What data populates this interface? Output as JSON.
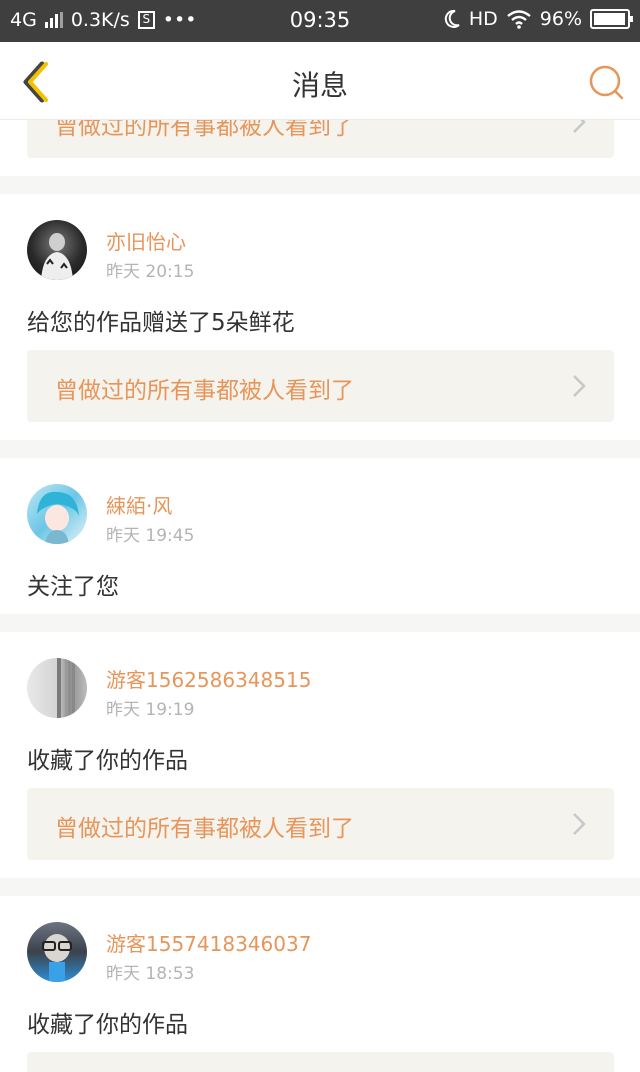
{
  "status_bar": {
    "network": "4G",
    "speed": "0.3K/s",
    "s_icon": "S",
    "more": "•••",
    "time": "09:35",
    "hd": "HD",
    "battery": "96%",
    "battery_level": 0.96
  },
  "nav": {
    "title": "消息",
    "accent": "#e8955a"
  },
  "messages": [
    {
      "work_title": "曾做过的所有事都被人看到了"
    },
    {
      "username": "亦旧怡心",
      "time": "昨天 20:15",
      "action": "给您的作品赠送了5朵鲜花",
      "work_title": "曾做过的所有事都被人看到了"
    },
    {
      "username": "綀絔·风",
      "time": "昨天 19:45",
      "action": "关注了您"
    },
    {
      "username": "游客1562586348515",
      "time": "昨天 19:19",
      "action": "收藏了你的作品",
      "work_title": "曾做过的所有事都被人看到了"
    },
    {
      "username": "游客1557418346037",
      "time": "昨天 18:53",
      "action": "收藏了你的作品"
    }
  ]
}
